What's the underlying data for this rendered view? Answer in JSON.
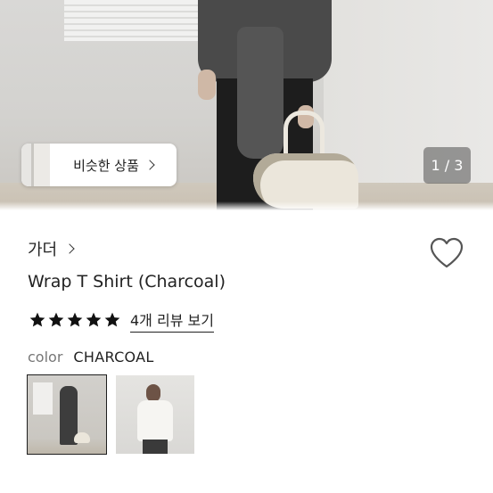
{
  "hero": {
    "similar_button_label": "비슷한 상품",
    "page_counter": "1 / 3"
  },
  "product": {
    "brand": "가더",
    "title": "Wrap T Shirt (Charcoal)",
    "rating_stars": 5,
    "review_link": "4개 리뷰 보기",
    "color_label": "color",
    "color_value": "CHARCOAL",
    "swatches": [
      {
        "name": "charcoal",
        "selected": true
      },
      {
        "name": "ivory",
        "selected": false
      }
    ]
  },
  "colors": {
    "text": "#222222",
    "muted": "#777777",
    "star": "#111111",
    "counter_bg": "#505050"
  },
  "icons": [
    "chevron-right-icon",
    "heart-icon",
    "star-icon"
  ]
}
